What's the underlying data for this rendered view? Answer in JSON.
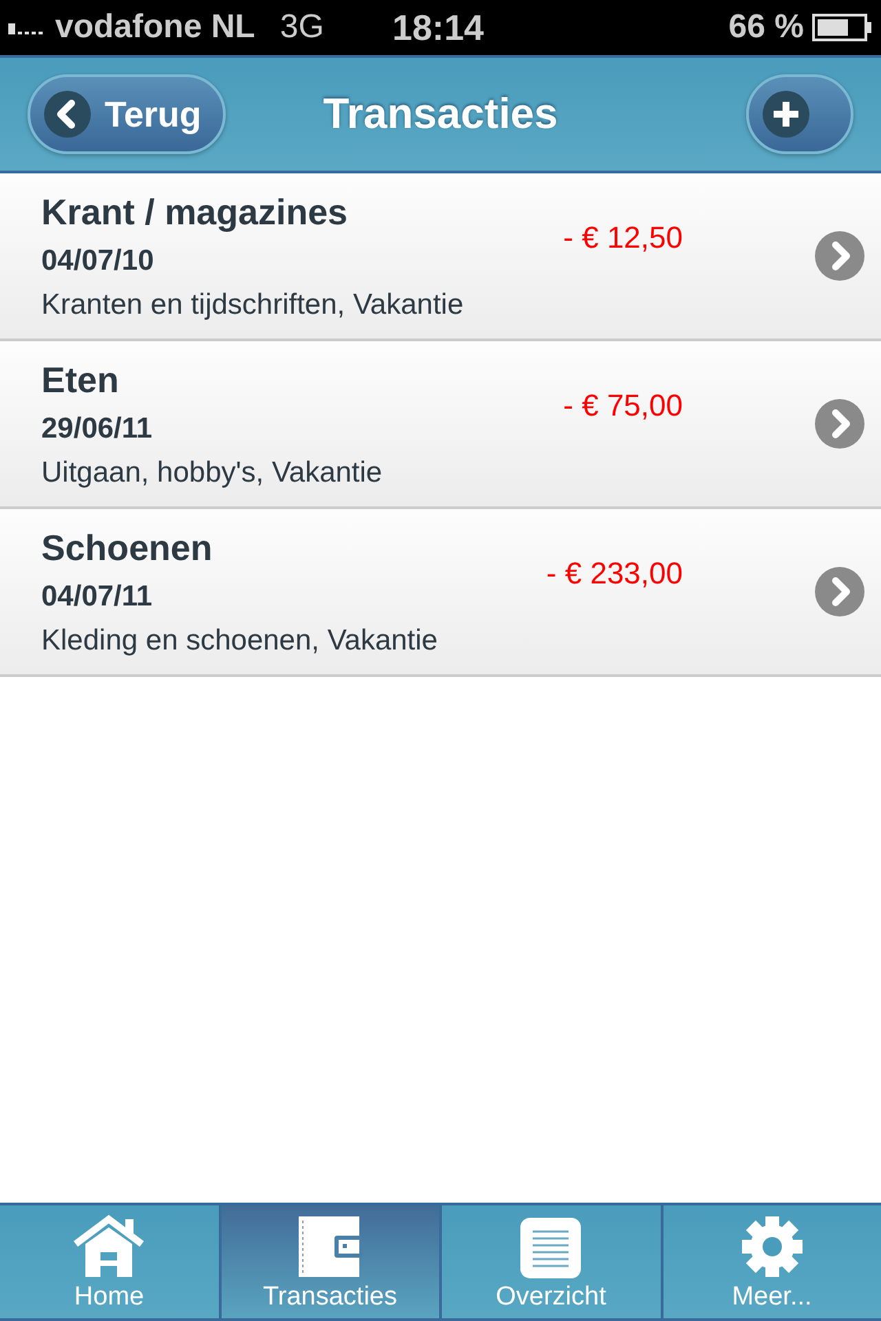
{
  "status_bar": {
    "carrier": "vodafone NL",
    "network": "3G",
    "time": "18:14",
    "battery": "66 %"
  },
  "nav_bar": {
    "back": "Terug",
    "title": "Transacties"
  },
  "transactions": [
    {
      "title": "Krant / magazines",
      "date": "04/07/10",
      "categories": "Kranten en tijdschriften, Vakantie",
      "amount": "- € 12,50"
    },
    {
      "title": "Eten",
      "date": "29/06/11",
      "categories": "Uitgaan, hobby's, Vakantie",
      "amount": "- € 75,00"
    },
    {
      "title": "Schoenen",
      "date": "04/07/11",
      "categories": "Kleding en schoenen, Vakantie",
      "amount": "- € 233,00"
    }
  ],
  "tab_bar": [
    {
      "label": "Home",
      "selected": false
    },
    {
      "label": "Transacties",
      "selected": true
    },
    {
      "label": "Overzicht",
      "selected": false
    },
    {
      "label": "Meer...",
      "selected": false
    }
  ]
}
